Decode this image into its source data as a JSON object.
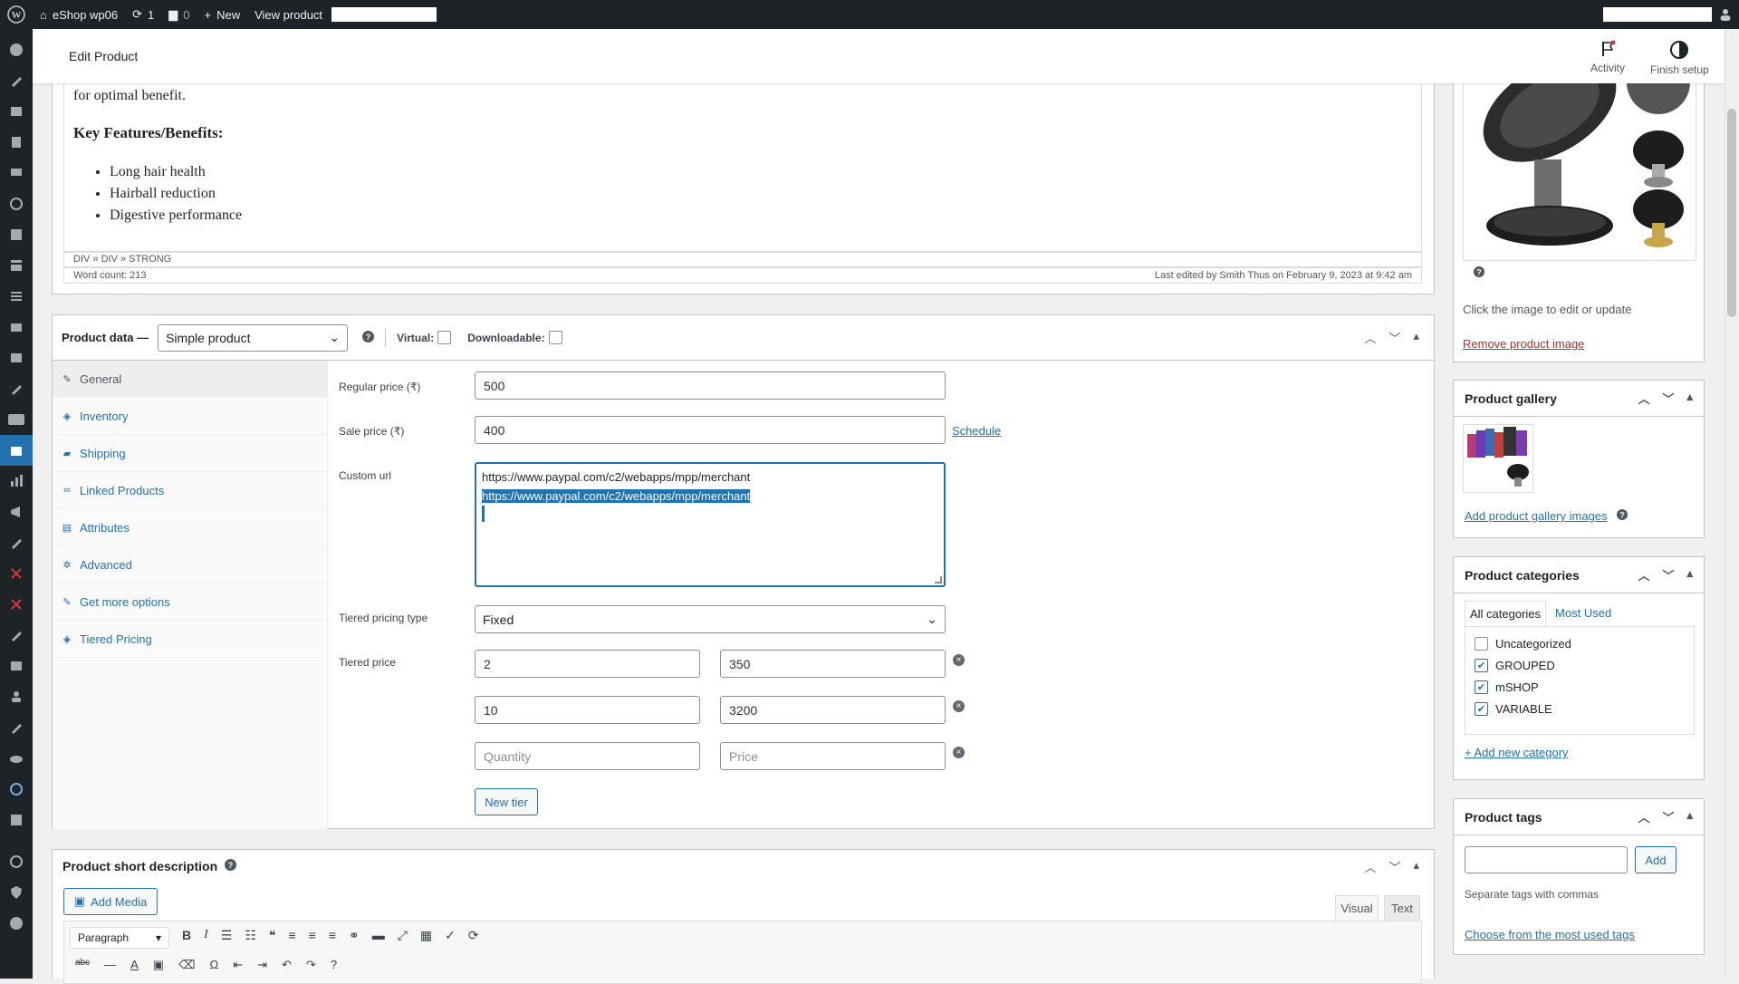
{
  "adminbar": {
    "site_name": "eShop wp06",
    "updates": "1",
    "comments": "0",
    "new_label": "New",
    "view_label": "View product"
  },
  "header": {
    "title": "Edit Product",
    "activity": "Activity",
    "finish_setup": "Finish setup"
  },
  "editor": {
    "intro_tail": "for optimal benefit.",
    "heading": "Key Features/Benefits:",
    "bullets": [
      "Long hair health",
      "Hairball reduction",
      "Digestive performance"
    ],
    "path": "DIV » DIV » STRONG",
    "word_count": "Word count: 213",
    "last_edited": "Last edited by Smith Thus on February 9, 2023 at 9:42 am"
  },
  "product_data": {
    "label": "Product data —",
    "type": "Simple product",
    "virtual": "Virtual:",
    "downloadable": "Downloadable:",
    "tabs": [
      "General",
      "Inventory",
      "Shipping",
      "Linked Products",
      "Attributes",
      "Advanced",
      "Get more options",
      "Tiered Pricing"
    ],
    "regular_price_label": "Regular price (₹)",
    "regular_price": "500",
    "sale_price_label": "Sale price (₹)",
    "sale_price": "400",
    "schedule": "Schedule",
    "custom_url_label": "Custom url",
    "custom_url_line1": "https://www.paypal.com/c2/webapps/mpp/merchant",
    "custom_url_line2": "https://www.paypal.com/c2/webapps/mpp/merchant",
    "tier_type_label": "Tiered pricing type",
    "tier_type": "Fixed",
    "tier_price_label": "Tiered price",
    "tiers": [
      {
        "qty": "2",
        "price": "350"
      },
      {
        "qty": "10",
        "price": "3200"
      }
    ],
    "qty_placeholder": "Quantity",
    "price_placeholder": "Price",
    "new_tier": "New tier"
  },
  "short_desc": {
    "title": "Product short description",
    "add_media": "Add Media",
    "visual": "Visual",
    "text": "Text",
    "format": "Paragraph"
  },
  "product_image": {
    "hint": "Click the image to edit or update",
    "remove": "Remove product image"
  },
  "gallery": {
    "title": "Product gallery",
    "add": "Add product gallery images"
  },
  "categories": {
    "title": "Product categories",
    "tab_all": "All categories",
    "tab_used": "Most Used",
    "items": [
      {
        "name": "Uncategorized",
        "checked": false
      },
      {
        "name": "GROUPED",
        "checked": true
      },
      {
        "name": "mSHOP",
        "checked": true
      },
      {
        "name": "VARIABLE",
        "checked": true
      }
    ],
    "add_new": "+ Add new category"
  },
  "tags": {
    "title": "Product tags",
    "add": "Add",
    "hint": "Separate tags with commas",
    "choose": "Choose from the most used tags"
  },
  "colors": {
    "accent": "#2271b1",
    "adminbar": "#1d2327",
    "danger": "#b32d2e"
  }
}
